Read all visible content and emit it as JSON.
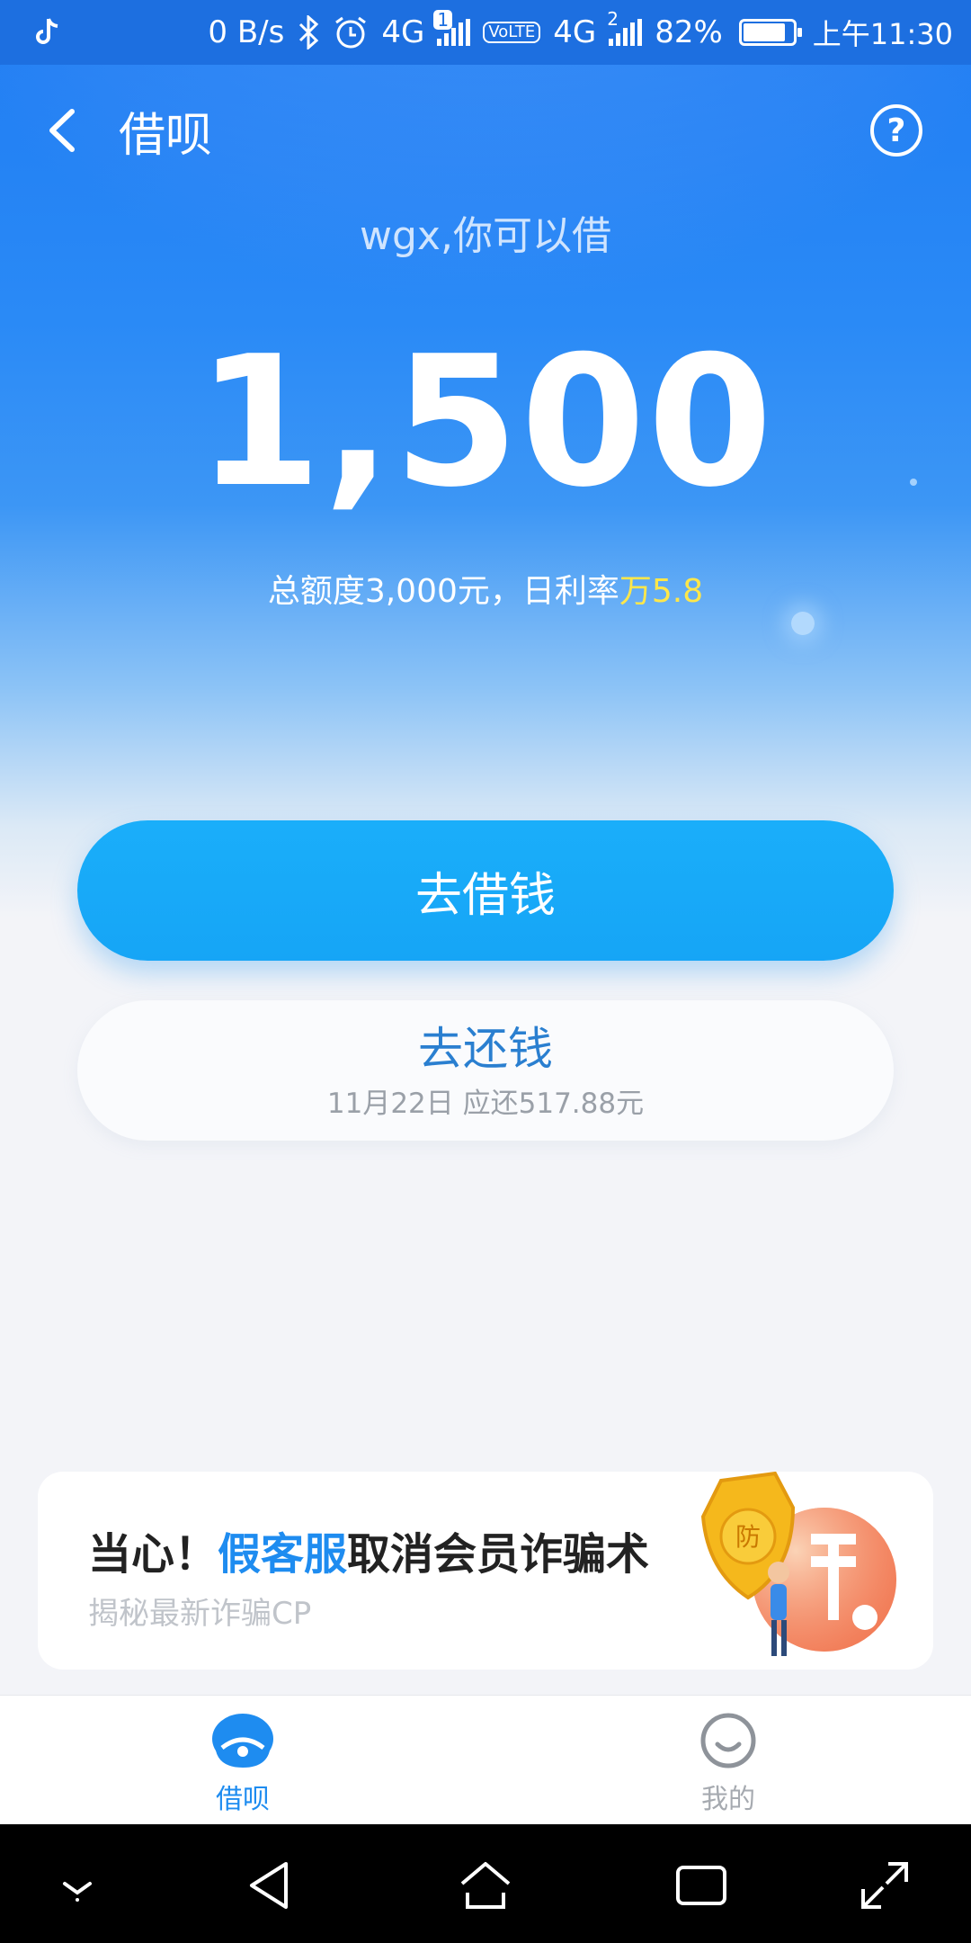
{
  "status_bar": {
    "net_speed": "0 B/s",
    "net1": "4G",
    "sim1_badge": "1",
    "volte": "VoLTE",
    "net2": "4G",
    "sim2_badge": "2",
    "battery": "82%",
    "time": "上午11:30"
  },
  "header": {
    "title": "借呗",
    "help_symbol": "?"
  },
  "hero": {
    "greeting": "wgx,你可以借",
    "amount": "1,500",
    "limit_prefix": "总额度3,000元，日利率",
    "rate": "万5.8"
  },
  "actions": {
    "borrow_label": "去借钱",
    "repay_label": "去还钱",
    "repay_sub": "11月22日 应还517.88元"
  },
  "promo": {
    "title_pre": "当心！",
    "title_hl": "假客服",
    "title_post": "取消会员诈骗术",
    "subtitle": "揭秘最新诈骗CP",
    "badge_char": "防"
  },
  "tabs": [
    {
      "label": "借呗",
      "active": true
    },
    {
      "label": "我的",
      "active": false
    }
  ],
  "colors": {
    "primary": "#1e8cf0",
    "button": "#16a5f6",
    "rate_highlight": "#ffe74a"
  }
}
